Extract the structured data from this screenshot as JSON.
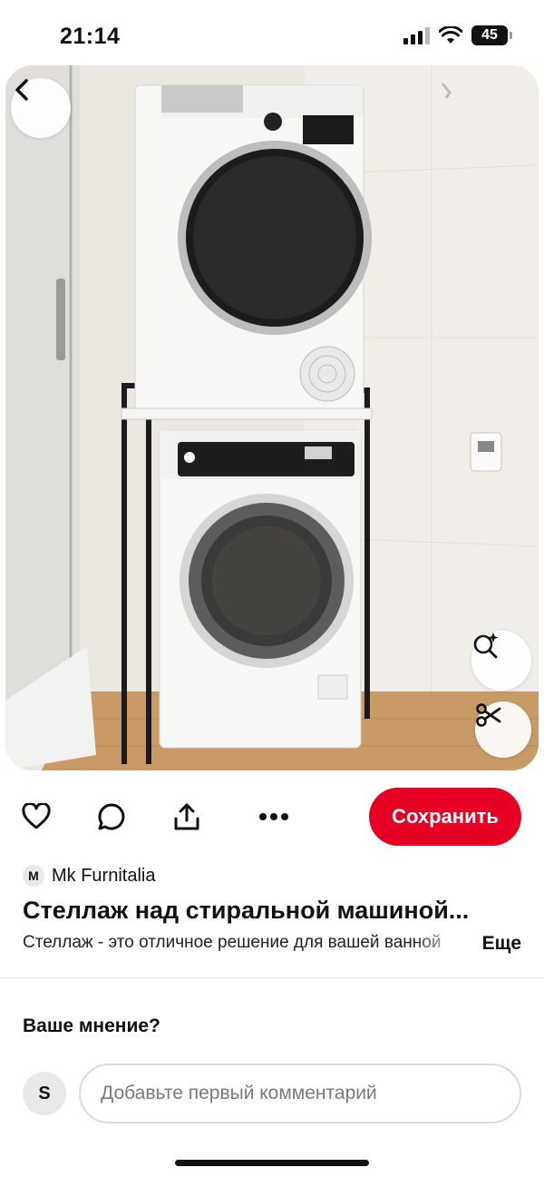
{
  "status": {
    "time": "21:14",
    "battery": "45",
    "icons": [
      "signal-icon",
      "wifi-icon",
      "battery-icon"
    ]
  },
  "hero": {
    "icons": {
      "back": "chevron-left-icon",
      "lens": "visual-search-icon",
      "cut": "scissors-icon"
    }
  },
  "actions": {
    "icons": [
      "heart-icon",
      "comment-icon",
      "share-icon",
      "more-icon"
    ],
    "save_label": "Сохранить",
    "accent": "#e60023"
  },
  "pin": {
    "author_initial": "M",
    "author_name": "Mk Furnitalia",
    "title": "Стеллаж над стиральной машиной...",
    "description": "Стеллаж - это отличное решение для вашей ванной",
    "more_label": "Еще"
  },
  "comments": {
    "heading": "Ваше мнение?",
    "user_initial": "S",
    "placeholder": "Добавьте первый комментарий"
  }
}
